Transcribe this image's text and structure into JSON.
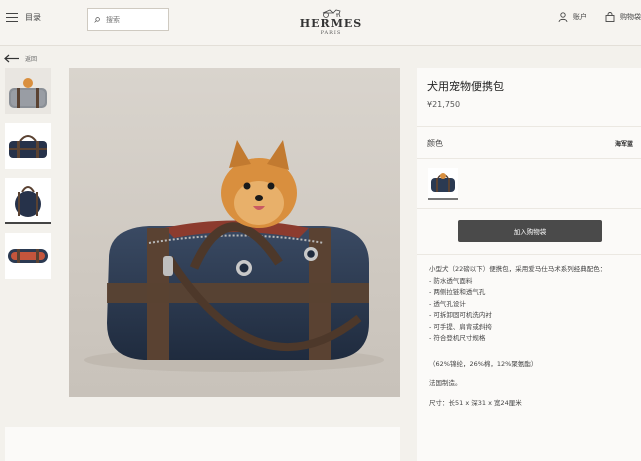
{
  "header": {
    "menu_label": "目录",
    "search_placeholder": "搜索",
    "brand": "HERMES",
    "brand_city": "PARIS",
    "account_label": "账户",
    "cart_label": "购物袋"
  },
  "nav": {
    "back_label": "返回"
  },
  "gallery": {
    "thumbnails": [
      "thumbnail-1",
      "thumbnail-2",
      "thumbnail-3",
      "thumbnail-4"
    ],
    "active_index": 2
  },
  "product": {
    "title": "犬用宠物便携包",
    "price": "¥21,750",
    "color_label": "颜色",
    "color_value": "海军蓝",
    "add_to_cart": "加入购物袋",
    "intro": "小型犬（22磅以下）便携包，采用爱马仕马术系列经典配色：",
    "features": [
      "防水透气面料",
      "两侧拉链和透气孔",
      "透气孔设计",
      "可拆卸固可机洗内衬",
      "可手提、肩背或斜挎",
      "符合登机尺寸规格"
    ],
    "material": "（62%锦纶，26%棉，12%聚氨酯）",
    "origin": "法国制造。",
    "size": "尺寸：长51 x 深31 x 宽24厘米"
  },
  "colors": {
    "bag_navy": "#2b3a52",
    "strap_brown": "#5a4232",
    "button_dark": "#4a4a4a",
    "background": "#f3f1ec",
    "dog_orange": "#d98f3e"
  }
}
